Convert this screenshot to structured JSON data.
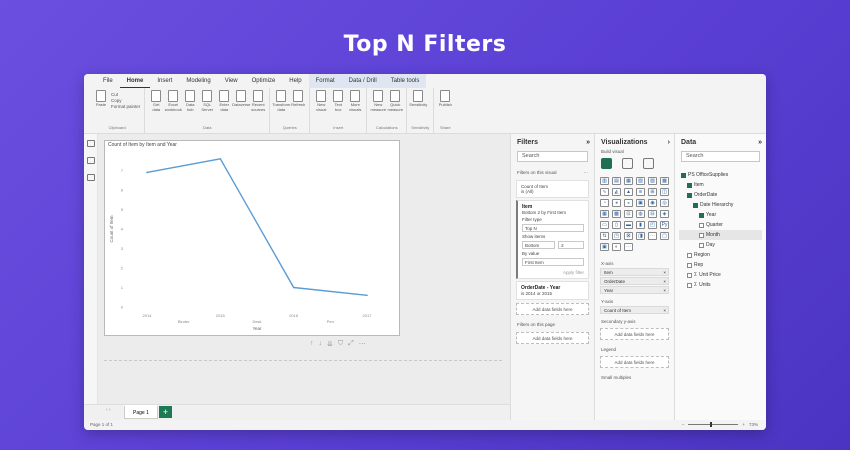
{
  "banner": {
    "title": "Top N Filters"
  },
  "ribbon": {
    "tabs": [
      "File",
      "Home",
      "Insert",
      "Modeling",
      "View",
      "Optimize",
      "Help",
      "Format",
      "Data / Drill",
      "Table tools"
    ],
    "active_tab": "Home",
    "clipboard": {
      "paste": "Paste",
      "cut": "Cut",
      "copy": "Copy",
      "format_painter": "Format painter",
      "group": "Clipboard"
    },
    "data_buttons": [
      "Get data",
      "Excel workbook",
      "Data hub",
      "SQL Server",
      "Enter data",
      "Dataverse",
      "Recent sources"
    ],
    "data_group": "Data",
    "queries_buttons": [
      "Transform data",
      "Refresh"
    ],
    "queries_group": "Queries",
    "insert_buttons": [
      "New visual",
      "Text box",
      "More visuals"
    ],
    "insert_group": "Insert",
    "calc_buttons": [
      "New measure",
      "Quick measure"
    ],
    "calc_group": "Calculations",
    "sensitivity_buttons": [
      "Sensitivity"
    ],
    "sensitivity_group": "Sensitivity",
    "share_buttons": [
      "Publish"
    ],
    "share_group": "Share"
  },
  "visual": {
    "title": "Count of Item by Item and Year"
  },
  "chart_data": {
    "type": "line",
    "title": "Count of Item by Item and Year",
    "xlabel": "Year",
    "ylabel": "Count of Item",
    "categories": [
      "2014",
      "2015",
      "2016",
      "2017"
    ],
    "category_groups": [
      "Binder",
      "Desk",
      "Pen"
    ],
    "values": [
      6.9,
      7.6,
      1.0,
      0.6
    ],
    "ylim": [
      0,
      8
    ],
    "yticks": [
      "0",
      "1",
      "2",
      "3",
      "4",
      "5",
      "6",
      "7"
    ],
    "color": "#5b9bd5"
  },
  "pages": {
    "tab": "Page 1",
    "status": "Page 1 of 1",
    "zoom": "73%"
  },
  "filters": {
    "title": "Filters",
    "search_placeholder": "Search",
    "on_visual_label": "Filters on this visual",
    "count_card": {
      "name": "Count of Item",
      "value": "is (All)"
    },
    "item_card": {
      "name": "Item",
      "desc": "Bottom 2 by First Item",
      "filter_type_label": "Filter type",
      "filter_type": "Top N",
      "show_items_label": "Show items",
      "direction": "Bottom",
      "count": "2",
      "by_value_label": "By value",
      "by_value": "First Item",
      "apply": "Apply filter"
    },
    "order_card": {
      "name": "OrderDate - Year",
      "value": "is 2014 or 2015"
    },
    "add_fields": "Add data fields here",
    "on_page_label": "Filters on this page",
    "add_fields_page": "Add data fields here"
  },
  "visualizations": {
    "title": "Visualizations",
    "build_visual": "Build visual",
    "wells": {
      "x_axis_label": "X-axis",
      "x_items": [
        "Item",
        "OrderDate",
        "Year"
      ],
      "y_axis_label": "Y-axis",
      "y_items": [
        "Count of Item"
      ],
      "secondary_label": "Secondary y-axis",
      "secondary_add": "Add data fields here",
      "legend_label": "Legend",
      "legend_add": "Add data fields here",
      "small_multiples_label": "Small multiples"
    }
  },
  "data": {
    "title": "Data",
    "search_placeholder": "Search",
    "tree": [
      {
        "label": "PS OfficeSupplies",
        "checked": true,
        "level": 0
      },
      {
        "label": "Item",
        "checked": true,
        "level": 1
      },
      {
        "label": "OrderDate",
        "checked": true,
        "level": 1
      },
      {
        "label": "Date Hierarchy",
        "checked": true,
        "level": 2
      },
      {
        "label": "Year",
        "checked": true,
        "level": 3
      },
      {
        "label": "Quarter",
        "checked": false,
        "level": 3
      },
      {
        "label": "Month",
        "checked": false,
        "level": 3
      },
      {
        "label": "Day",
        "checked": false,
        "level": 3
      },
      {
        "label": "Region",
        "checked": false,
        "level": 1
      },
      {
        "label": "Rep",
        "checked": false,
        "level": 1
      },
      {
        "label": "Unit Price",
        "checked": false,
        "level": 1
      },
      {
        "label": "Units",
        "checked": false,
        "level": 1
      }
    ]
  }
}
